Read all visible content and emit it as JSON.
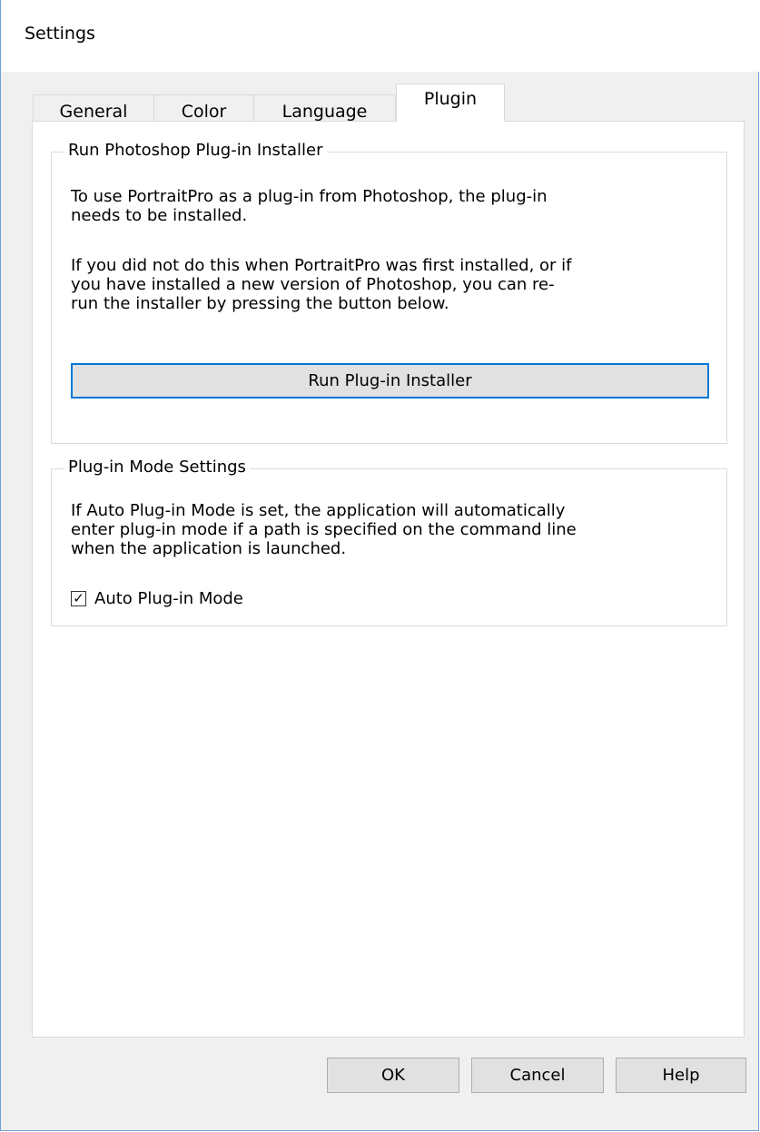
{
  "window": {
    "title": "Settings"
  },
  "tabs": [
    {
      "label": "General"
    },
    {
      "label": "Color"
    },
    {
      "label": "Language"
    },
    {
      "label": "Plugin",
      "selected": true
    }
  ],
  "installer_group": {
    "legend": "Run Photoshop Plug-in Installer",
    "paragraph1": "To use PortraitPro as a plug-in from Photoshop, the plug-in\nneeds to be installed.",
    "paragraph2": "If you did not do this when PortraitPro was first installed, or if\nyou have installed a new version of Photoshop, you can re-\nrun the installer by pressing the button below.",
    "button_label": "Run Plug-in Installer"
  },
  "mode_group": {
    "legend": "Plug-in Mode Settings",
    "paragraph": "If Auto Plug-in Mode is set, the application will automatically\nenter plug-in mode if a path is specified on the command line\nwhen the application is launched.",
    "checkbox_label": "Auto Plug-in Mode",
    "checkbox_checked": true,
    "check_glyph": "✓"
  },
  "buttons": {
    "ok": "OK",
    "cancel": "Cancel",
    "help": "Help"
  },
  "colors": {
    "accent": "#0078d7",
    "window_border": "#6f9fd8"
  }
}
